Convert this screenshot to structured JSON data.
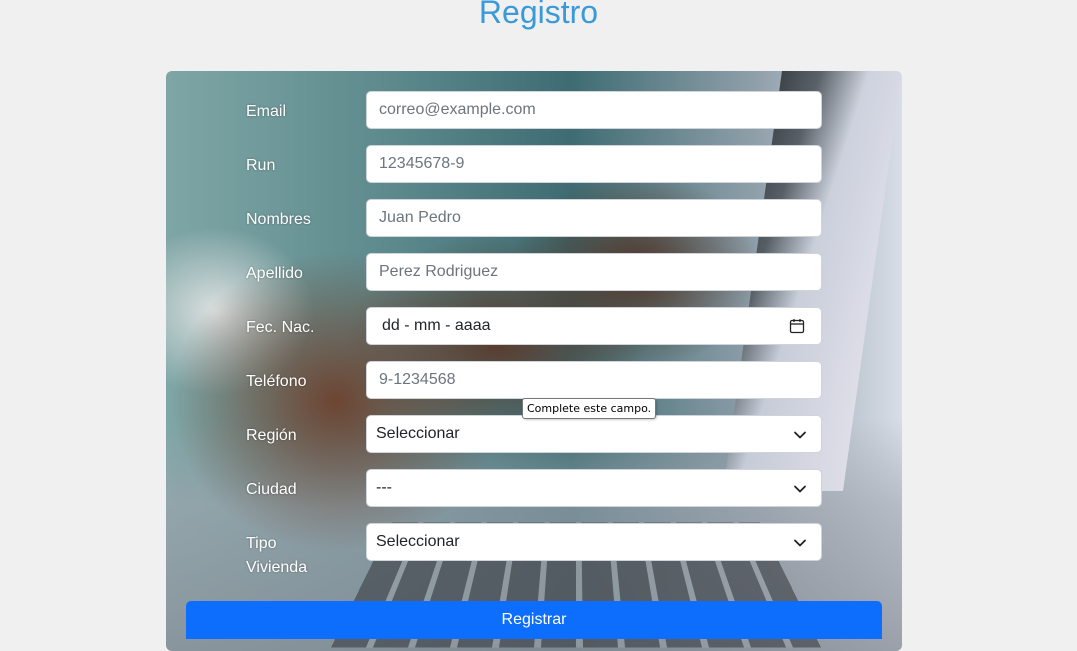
{
  "page": {
    "title": "Registro"
  },
  "form": {
    "email": {
      "label": "Email",
      "placeholder": "correo@example.com"
    },
    "run": {
      "label": "Run",
      "placeholder": "12345678-9"
    },
    "nombres": {
      "label": "Nombres",
      "placeholder": "Juan Pedro"
    },
    "apellido": {
      "label": "Apellido",
      "placeholder": "Perez Rodriguez"
    },
    "fecha": {
      "label": "Fec. Nac.",
      "display": "dd - mm - aaaa",
      "icon": "calendar-icon"
    },
    "telefono": {
      "label": "Teléfono",
      "placeholder": "9-1234568"
    },
    "region": {
      "label": "Región",
      "value": "Seleccionar"
    },
    "ciudad": {
      "label": "Ciudad",
      "value": "---"
    },
    "vivienda": {
      "label_line1": "Tipo",
      "label_line2": "Vivienda",
      "value": "Seleccionar"
    },
    "validation_tooltip": "Complete este campo.",
    "submit_label": "Registrar"
  },
  "colors": {
    "title": "#3a9ad9",
    "primary": "#0d6efd",
    "background": "#f0f0f0"
  }
}
